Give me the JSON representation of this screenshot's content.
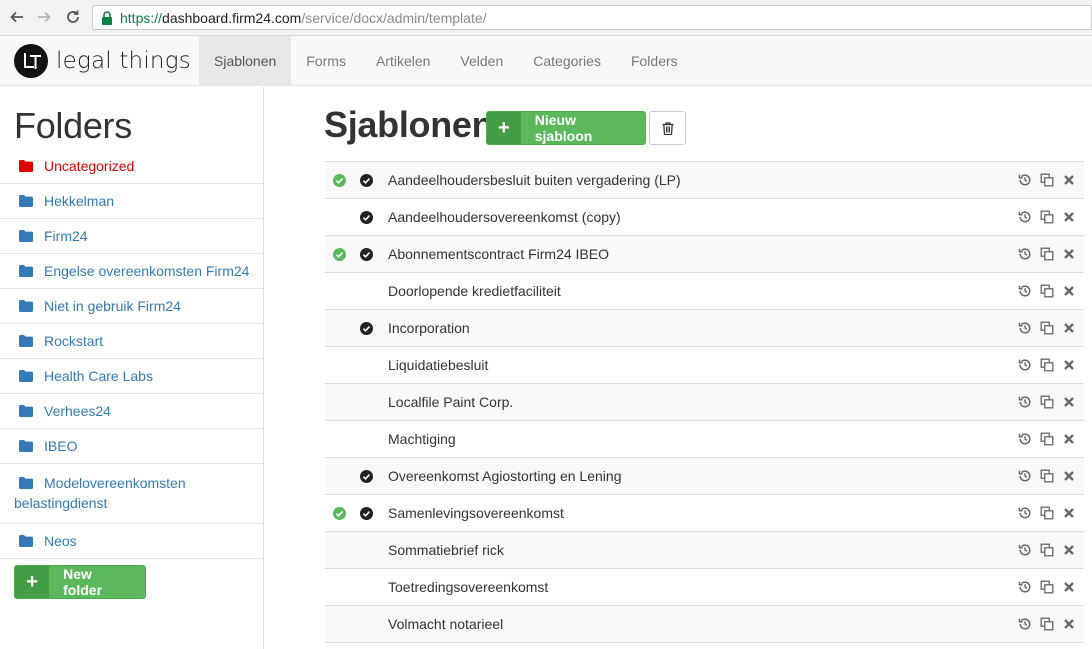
{
  "browser": {
    "url_scheme": "https://",
    "url_host": "dashboard.firm24.com",
    "url_path": "/service/docx/admin/template/",
    "icons": [
      "back-arrow-icon",
      "forward-arrow-icon",
      "reload-icon",
      "lock-icon"
    ]
  },
  "app": {
    "brand": "legal things",
    "nav_tabs": [
      {
        "label": "Sjablonen",
        "active": true
      },
      {
        "label": "Forms",
        "active": false
      },
      {
        "label": "Artikelen",
        "active": false
      },
      {
        "label": "Velden",
        "active": false
      },
      {
        "label": "Categories",
        "active": false
      },
      {
        "label": "Folders",
        "active": false
      }
    ]
  },
  "sidebar": {
    "title": "Folders",
    "folders": [
      {
        "label": "Uncategorized"
      },
      {
        "label": "Hekkelman"
      },
      {
        "label": "Firm24"
      },
      {
        "label": "Engelse overeenkomsten Firm24"
      },
      {
        "label": "Niet in gebruik Firm24"
      },
      {
        "label": "Rockstart"
      },
      {
        "label": "Health Care Labs"
      },
      {
        "label": "Verhees24"
      },
      {
        "label": "IBEO"
      },
      {
        "label": "Modelovereenkomsten belastingdienst"
      },
      {
        "label": "Neos"
      }
    ],
    "new_folder_button": {
      "plus": "+",
      "label": "New folder"
    }
  },
  "main": {
    "title": "Sjablonen",
    "new_template_button": {
      "plus": "+",
      "label": "Nieuw sjabloon"
    },
    "templates": [
      {
        "name": "Aandeelhoudersbesluit buiten vergadering (LP)",
        "green_check": true,
        "black_check": true
      },
      {
        "name": "Aandeelhoudersovereenkomst (copy)",
        "green_check": false,
        "black_check": true
      },
      {
        "name": "Abonnementscontract Firm24 IBEO",
        "green_check": true,
        "black_check": true
      },
      {
        "name": "Doorlopende kredietfaciliteit",
        "green_check": false,
        "black_check": false
      },
      {
        "name": "Incorporation",
        "green_check": false,
        "black_check": true
      },
      {
        "name": "Liquidatiebesluit",
        "green_check": false,
        "black_check": false
      },
      {
        "name": "Localfile Paint Corp.",
        "green_check": false,
        "black_check": false
      },
      {
        "name": "Machtiging",
        "green_check": false,
        "black_check": false
      },
      {
        "name": "Overeenkomst Agiostorting en Lening",
        "green_check": false,
        "black_check": true
      },
      {
        "name": "Samenlevingsovereenkomst",
        "green_check": true,
        "black_check": true
      },
      {
        "name": "Sommatiebrief rick",
        "green_check": false,
        "black_check": false
      },
      {
        "name": "Toetredingsovereenkomst",
        "green_check": false,
        "black_check": false
      },
      {
        "name": "Volmacht notarieel",
        "green_check": false,
        "black_check": false
      }
    ],
    "row_action_icons": [
      "history-icon",
      "copy-icon",
      "delete-icon"
    ]
  },
  "colors": {
    "link": "#337ab7",
    "uncategorized": "#e00000",
    "success": "#5cb85c",
    "green_check": "#5cb85c",
    "black_check": "#222222"
  }
}
